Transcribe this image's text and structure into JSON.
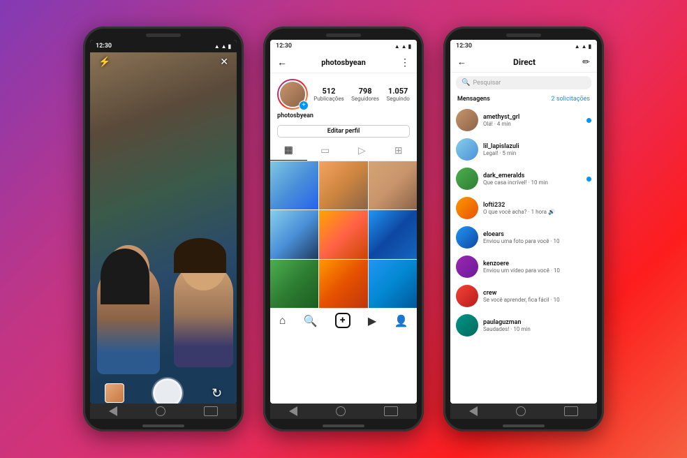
{
  "background": {
    "gradient": "135deg, #833ab4 0%, #c13584 30%, #e1306c 55%, #fd1d1d 80%, #f56040 100%"
  },
  "phone1": {
    "type": "camera",
    "status_time": "12:30",
    "top_left_icon": "flash-off",
    "top_right_icon": "close",
    "bottom_left": "gallery",
    "bottom_center": "shutter",
    "bottom_right": "flip"
  },
  "phone2": {
    "type": "profile",
    "status_time": "12:30",
    "username": "photosbyean",
    "stats": {
      "posts": "512",
      "posts_label": "Publicações",
      "followers": "798",
      "followers_label": "Seguidores",
      "following": "1.057",
      "following_label": "Seguindo"
    },
    "edit_button": "Editar perfil",
    "tabs": [
      "grid",
      "reels",
      "video",
      "tag"
    ],
    "bottom_nav": [
      "home",
      "search",
      "add",
      "reels",
      "profile"
    ]
  },
  "phone3": {
    "type": "direct",
    "status_time": "12:30",
    "title": "Direct",
    "back_icon": "arrow-left",
    "compose_icon": "compose",
    "search_placeholder": "Pesquisar",
    "messages_label": "Mensagens",
    "solicitations": "2 solicitações",
    "messages": [
      {
        "user": "amethyst_grl",
        "preview": "Olá! · 4 min",
        "unread": true
      },
      {
        "user": "lil_lapislazuli",
        "preview": "Legal! · 5 min",
        "unread": false
      },
      {
        "user": "dark_emeralds",
        "preview": "Que casa incrível! · 10 min",
        "unread": true
      },
      {
        "user": "lofti232",
        "preview": "O que você acha? · 1 hora",
        "unread": false
      },
      {
        "user": "eloears",
        "preview": "Enviou uma foto para você · 10",
        "unread": false
      },
      {
        "user": "kenzoere",
        "preview": "Enviou um vídeo para você · 10",
        "unread": false
      },
      {
        "user": "crew",
        "preview": "Se você aprender, fica fácil · 10",
        "unread": false
      },
      {
        "user": "paulaguzman",
        "preview": "Saudades! · 10 min",
        "unread": false
      }
    ]
  }
}
